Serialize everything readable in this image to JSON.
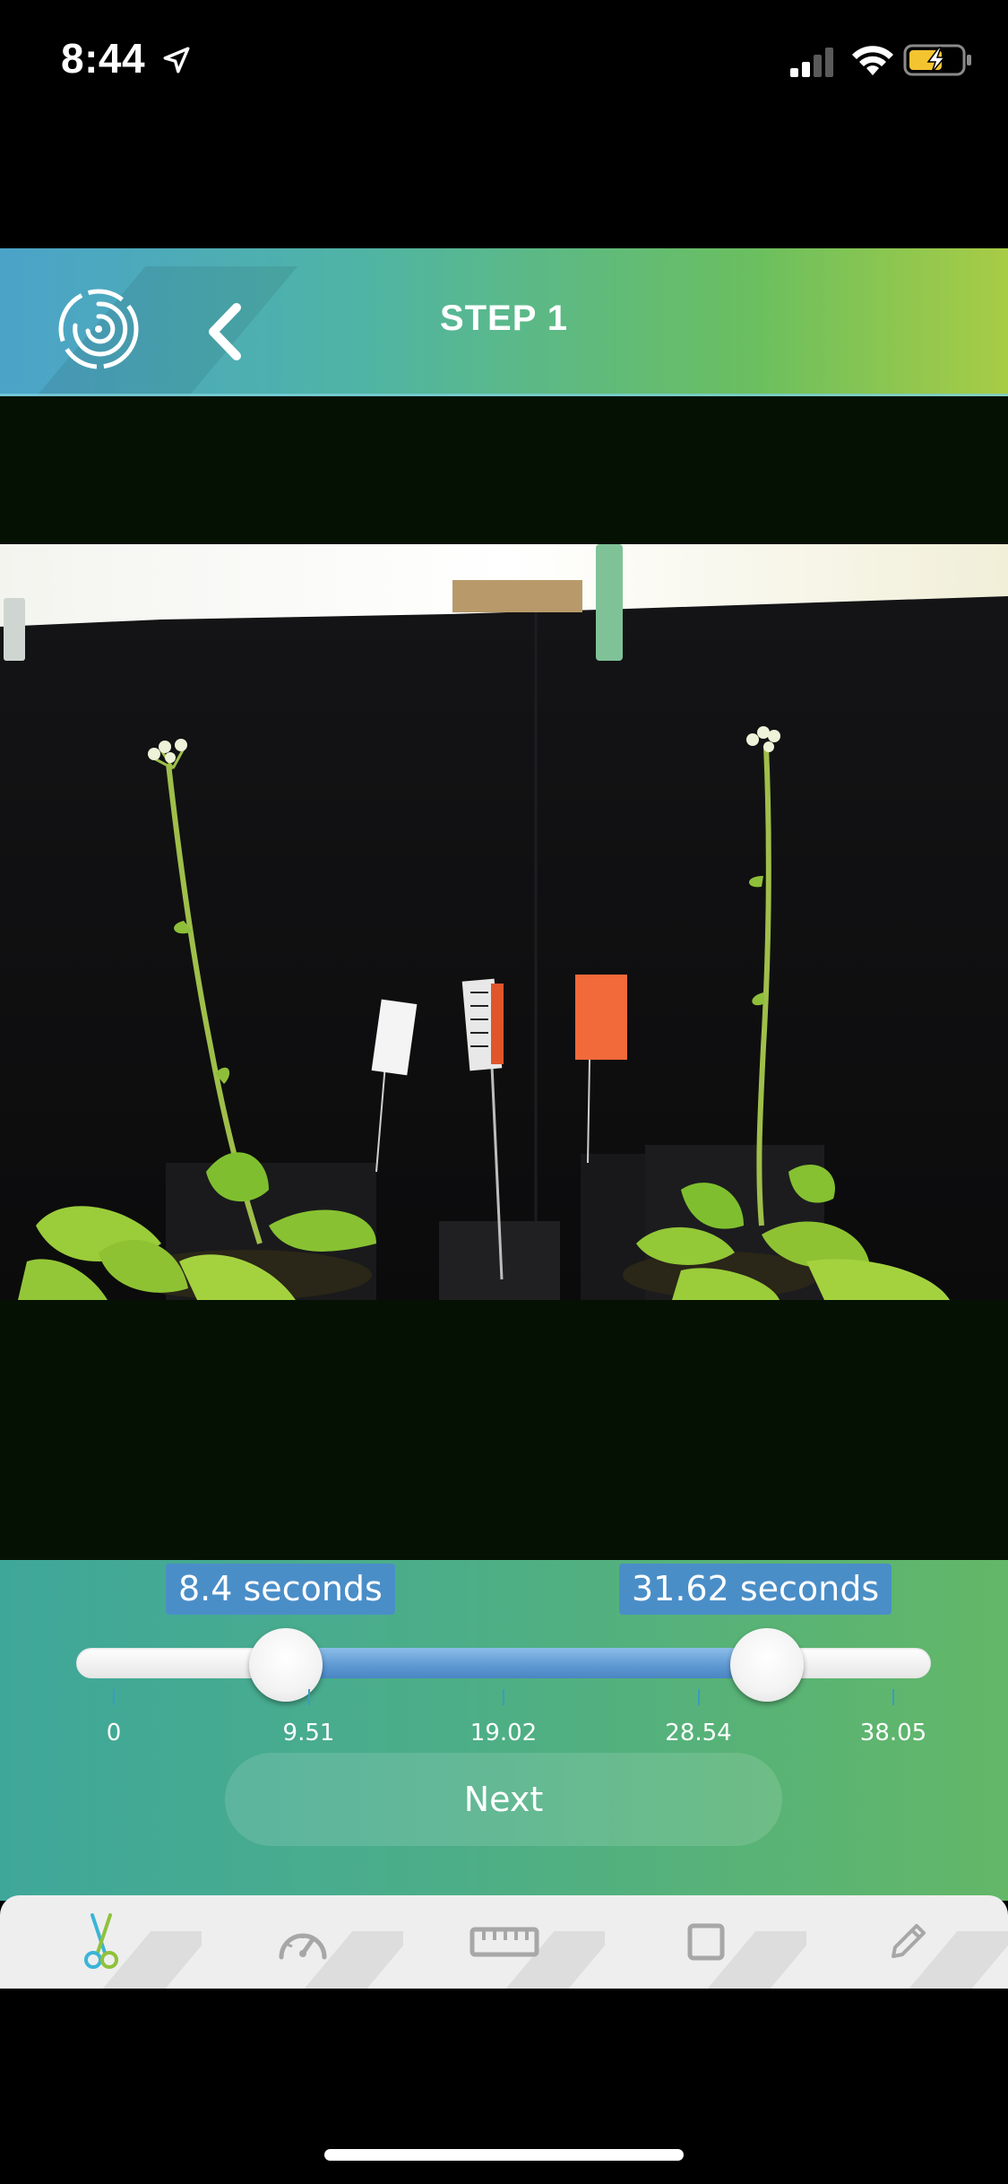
{
  "status_bar": {
    "time": "8:44",
    "icons": [
      "location-arrow-icon",
      "cellular-signal-icon",
      "wifi-icon",
      "battery-charging-icon"
    ]
  },
  "header": {
    "title": "STEP 1",
    "logo_icon": "spiral-logo-icon",
    "back_icon": "chevron-left-icon"
  },
  "trim": {
    "start_label": "8.4 seconds",
    "end_label": "31.62 seconds",
    "start_value": 8.4,
    "end_value": 31.62,
    "min": 0,
    "max": 38.05,
    "ticks": [
      "0",
      "9.51",
      "19.02",
      "28.54",
      "38.05"
    ],
    "next_label": "Next"
  },
  "tabs": [
    {
      "name": "trim",
      "icon": "scissors-icon",
      "active": true
    },
    {
      "name": "speed",
      "icon": "speedometer-icon",
      "active": false
    },
    {
      "name": "measure",
      "icon": "ruler-icon",
      "active": false
    },
    {
      "name": "crop",
      "icon": "crop-square-icon",
      "active": false
    },
    {
      "name": "annotate",
      "icon": "pencil-icon",
      "active": false
    }
  ],
  "colors": {
    "header_gradient": [
      "#4ba3c9",
      "#6bbf5f",
      "#a8cc45"
    ],
    "panel_gradient": [
      "#3fa79a",
      "#63b767"
    ],
    "badge": "#4a8ec8",
    "range_fill": "#5d98d2",
    "video_letterbox": "#051203"
  }
}
